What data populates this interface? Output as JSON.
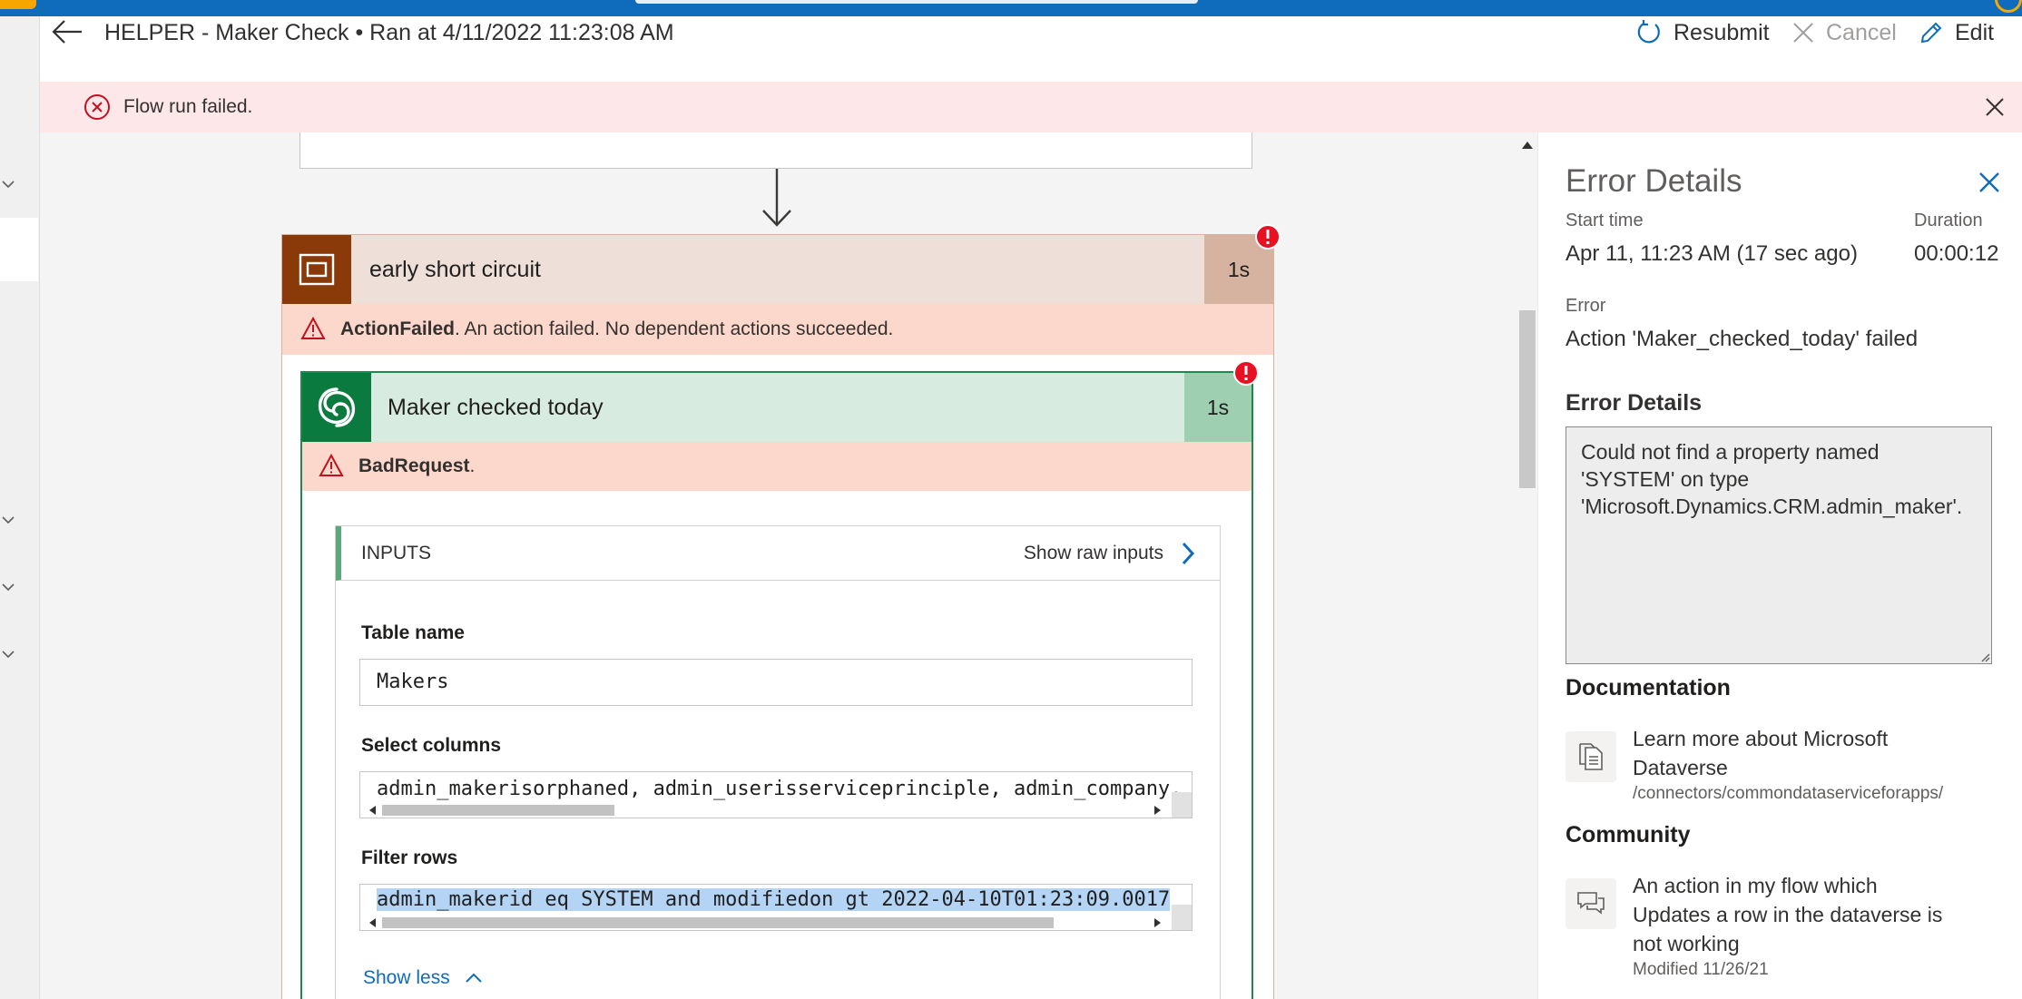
{
  "header": {
    "title": "HELPER - Maker Check • Ran at 4/11/2022 11:23:08 AM",
    "resubmit_label": "Resubmit",
    "cancel_label": "Cancel",
    "edit_label": "Edit"
  },
  "banner": {
    "message": "Flow run failed."
  },
  "scope_action": {
    "title": "early short circuit",
    "duration": "1s",
    "error_code": "ActionFailed",
    "error_message": ". An action failed. No dependent actions succeeded."
  },
  "inner_action": {
    "title": "Maker checked today",
    "duration": "1s",
    "error_code": "BadRequest",
    "error_suffix": ".",
    "inputs_label": "INPUTS",
    "show_raw_label": "Show raw inputs",
    "fields": [
      {
        "label": "Table name",
        "value": "Makers"
      },
      {
        "label": "Select columns",
        "value": "admin_makerisorphaned, admin_userisserviceprinciple, admin_company,"
      },
      {
        "label": "Filter rows",
        "value": "admin_makerid eq SYSTEM and modifiedon gt 2022-04-10T01:23:09.0017"
      }
    ],
    "show_less_label": "Show less"
  },
  "panel": {
    "title": "Error Details",
    "start_time_label": "Start time",
    "start_time_value": "Apr 11, 11:23 AM (17 sec ago)",
    "duration_label": "Duration",
    "duration_value": "00:00:12",
    "error_label": "Error",
    "error_value": "Action 'Maker_checked_today' failed",
    "details_label": "Error Details",
    "details_text": "Could not find a property named\n'SYSTEM' on type\n'Microsoft.Dynamics.CRM.admin_maker'.",
    "documentation_label": "Documentation",
    "doc_link_line1": "Learn more about Microsoft",
    "doc_link_line2": "Dataverse",
    "doc_path": "/connectors/commondataserviceforapps/",
    "community_label": "Community",
    "community_line1": "An action in my flow which",
    "community_line2": "Updates a row in the dataverse is",
    "community_line3": "not working",
    "community_meta": "Modified 11/26/21"
  },
  "colors": {
    "scope_brown": "#8a3a08",
    "scope_header_bg": "#eee0d8",
    "scope_duration_bg": "#d6b3a0",
    "dataverse_green": "#0b7a3e",
    "inner_header_bg": "#d7ebe0",
    "inner_duration_bg": "#9fcfb1",
    "error_row_bg": "#fcd8cc",
    "error_badge": "#e81123",
    "link_blue": "#0f6cbd"
  }
}
